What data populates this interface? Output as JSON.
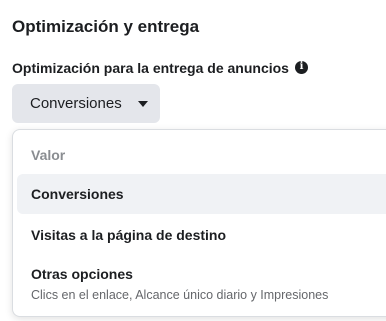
{
  "section": {
    "title": "Optimización y entrega"
  },
  "field": {
    "label": "Optimización para la entrega de anuncios",
    "info_icon": "info-icon"
  },
  "dropdown": {
    "selected_label": "Conversiones",
    "caret_icon": "caret-down-icon"
  },
  "menu": {
    "heading": "Valor",
    "items": [
      {
        "label": "Conversiones",
        "description": "",
        "selected": true
      },
      {
        "label": "Visitas a la página de destino",
        "description": "",
        "selected": false
      },
      {
        "label": "Otras opciones",
        "description": "Clics en el enlace, Alcance único diario y Impresiones",
        "selected": false
      }
    ]
  },
  "colors": {
    "text_primary": "#1c1e21",
    "text_secondary": "#65676b",
    "heading_muted": "#8a8d91",
    "button_bg": "#e4e6eb",
    "selected_bg": "#f0f2f5"
  }
}
